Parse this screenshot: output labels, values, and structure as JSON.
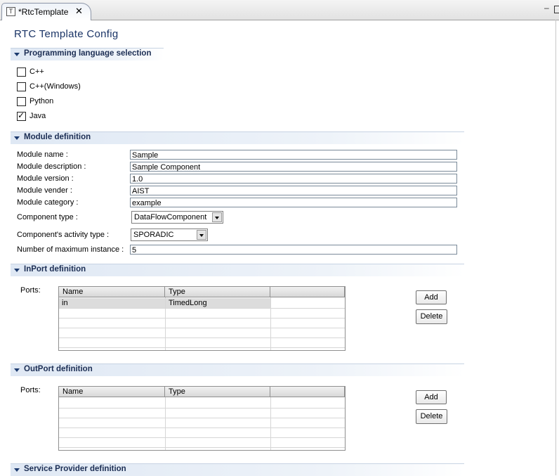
{
  "tab": {
    "title": "*RtcTemplate",
    "close_label": "✕",
    "icon_label": "T"
  },
  "window": {
    "minimize_label": "–"
  },
  "form": {
    "title": "RTC Template Config"
  },
  "language": {
    "section_title": "Programming language selection",
    "options": [
      {
        "label": "C++",
        "checked": false
      },
      {
        "label": "C++(Windows)",
        "checked": false
      },
      {
        "label": "Python",
        "checked": false
      },
      {
        "label": "Java",
        "checked": true
      }
    ]
  },
  "module": {
    "section_title": "Module definition",
    "name_label": "Module name :",
    "name_value": "Sample",
    "description_label": "Module description :",
    "description_value": "Sample Component",
    "version_label": "Module version :",
    "version_value": "1.0",
    "vender_label": "Module vender :",
    "vender_value": "AIST",
    "category_label": "Module category :",
    "category_value": "example",
    "component_type_label": "Component type :",
    "component_type_value": "DataFlowComponent",
    "activity_type_label": "Component's activity type :",
    "activity_type_value": "SPORADIC",
    "max_instance_label": "Number of maximum instance :",
    "max_instance_value": "5"
  },
  "inport": {
    "section_title": "InPort definition",
    "ports_label": "Ports:",
    "columns": [
      "Name",
      "Type"
    ],
    "rows": [
      {
        "name": "in",
        "type": "TimedLong"
      }
    ],
    "add_label": "Add",
    "delete_label": "Delete"
  },
  "outport": {
    "section_title": "OutPort definition",
    "ports_label": "Ports:",
    "columns": [
      "Name",
      "Type"
    ],
    "rows": [],
    "add_label": "Add",
    "delete_label": "Delete"
  },
  "service_provider": {
    "section_title": "Service Provider definition"
  }
}
